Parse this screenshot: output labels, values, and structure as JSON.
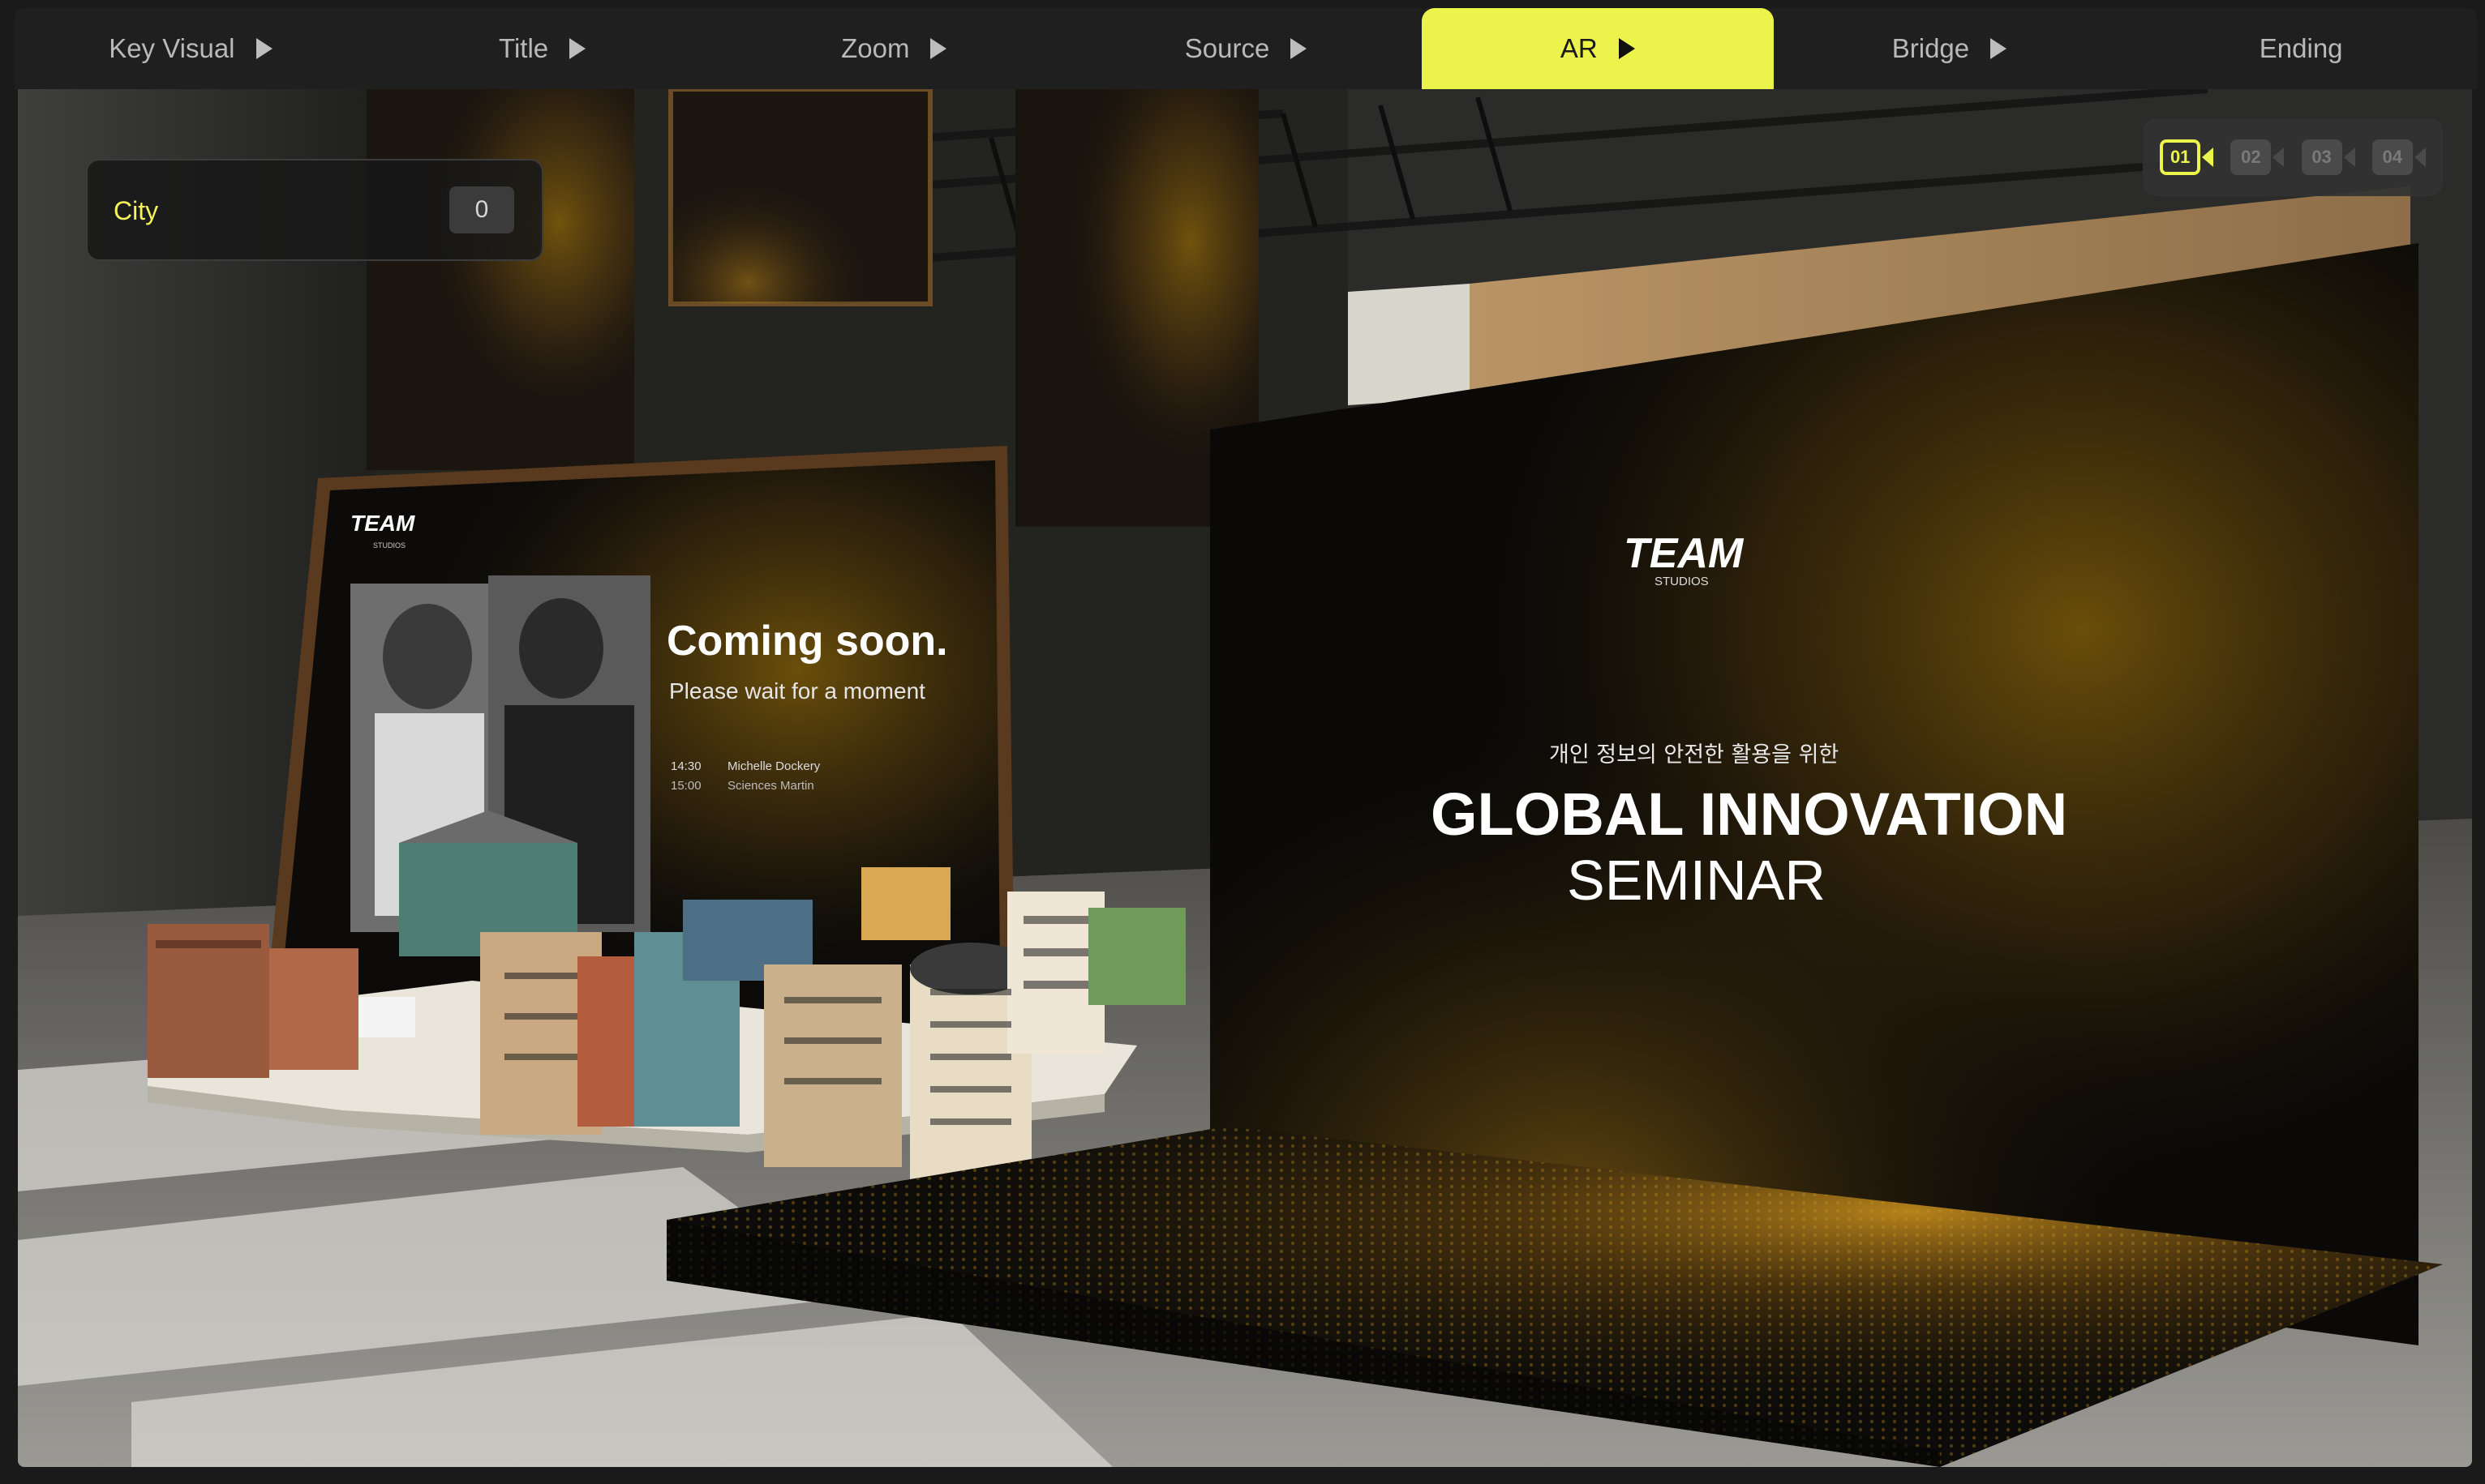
{
  "tabs": [
    {
      "label": "Key Visual",
      "has_play": true,
      "active": false
    },
    {
      "label": "Title",
      "has_play": true,
      "active": false
    },
    {
      "label": "Zoom",
      "has_play": true,
      "active": false
    },
    {
      "label": "Source",
      "has_play": true,
      "active": false
    },
    {
      "label": "AR",
      "has_play": true,
      "active": true
    },
    {
      "label": "Bridge",
      "has_play": true,
      "active": false
    },
    {
      "label": "Ending",
      "has_play": false,
      "active": false
    }
  ],
  "accent_color": "#ecf34a",
  "city_panel": {
    "label": "City",
    "count": "0"
  },
  "cameras": [
    {
      "label": "01",
      "active": true,
      "icon": "video-camera-icon"
    },
    {
      "label": "02",
      "active": false,
      "icon": "video-camera-icon"
    },
    {
      "label": "03",
      "active": false,
      "icon": "video-camera-icon"
    },
    {
      "label": "04",
      "active": false,
      "icon": "video-camera-icon"
    }
  ],
  "left_screen": {
    "brand": "TEAM",
    "brand_sub": "STUDIOS",
    "headline": "Coming soon.",
    "subline": "Please wait for a moment",
    "schedule": [
      {
        "time": "14:30",
        "name": "Michelle Dockery"
      },
      {
        "time": "15:00",
        "name": "Sciences Martin"
      }
    ]
  },
  "main_screen": {
    "brand": "TEAM",
    "brand_sub": "STUDIOS",
    "kicker": "개인 정보의 안전한 활용을 위한",
    "title_line1": "GLOBAL INNOVATION",
    "title_line2": "SEMINAR"
  }
}
